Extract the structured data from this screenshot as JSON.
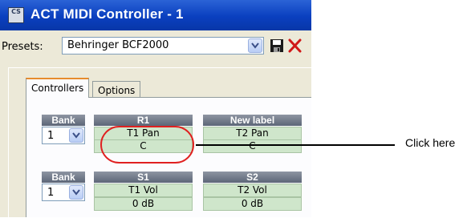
{
  "window": {
    "title": "ACT MIDI Controller - 1",
    "app_icon": {
      "name": "cakewalk-sonar-icon",
      "text": "CS"
    }
  },
  "presets": {
    "label": "Presets:",
    "selected": "Behringer BCF2000",
    "save_icon": "floppy-disk-icon",
    "delete_icon": "red-x-icon"
  },
  "tabs": [
    {
      "label": "Controllers",
      "active": true
    },
    {
      "label": "Options",
      "active": false
    }
  ],
  "controllers": {
    "rows": [
      {
        "bank_header": "Bank",
        "bank_value": "1",
        "controls": [
          {
            "header": "R1",
            "parameter": "T1 Pan",
            "value": "C"
          },
          {
            "header": "New label",
            "parameter": "T2 Pan",
            "value": "C"
          }
        ]
      },
      {
        "bank_header": "Bank",
        "bank_value": "1",
        "controls": [
          {
            "header": "S1",
            "parameter": "T1 Vol",
            "value": "0 dB"
          },
          {
            "header": "S2",
            "parameter": "T2 Vol",
            "value": "0 dB"
          }
        ]
      }
    ]
  },
  "annotation": {
    "text": "Click here",
    "color": "#e02020"
  }
}
